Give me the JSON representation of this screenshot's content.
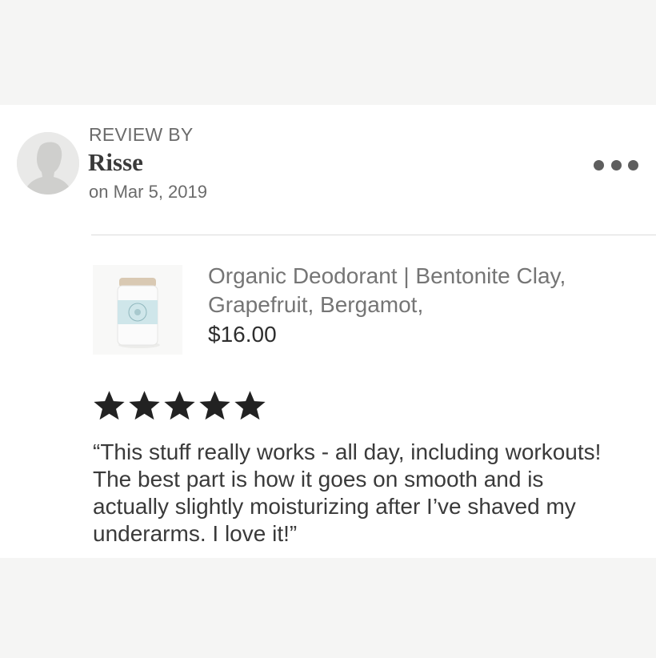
{
  "review": {
    "label": "REVIEW BY",
    "reviewer_name": "Risse",
    "date": "on Mar 5, 2019",
    "avatar_icon": "user-silhouette-icon",
    "menu_icon": "more-options-icon"
  },
  "product": {
    "title": "Organic Deodorant | Bentonite Clay, Grapefruit, Bergamot,",
    "price": "$16.00",
    "image_icon": "deodorant-stick-image"
  },
  "rating": {
    "stars": 5,
    "max": 5,
    "star_icon": "star-icon"
  },
  "review_text": "“This stuff really works - all day, including workouts! The best part is how it goes on smooth and is actually slightly moisturizing after I’ve shaved my underarms. I love it!”",
  "colors": {
    "page_background": "#f5f5f4",
    "card_background": "#ffffff",
    "text_dark": "#3a3a3a",
    "text_muted": "#6b6b6b",
    "star": "#222222"
  }
}
